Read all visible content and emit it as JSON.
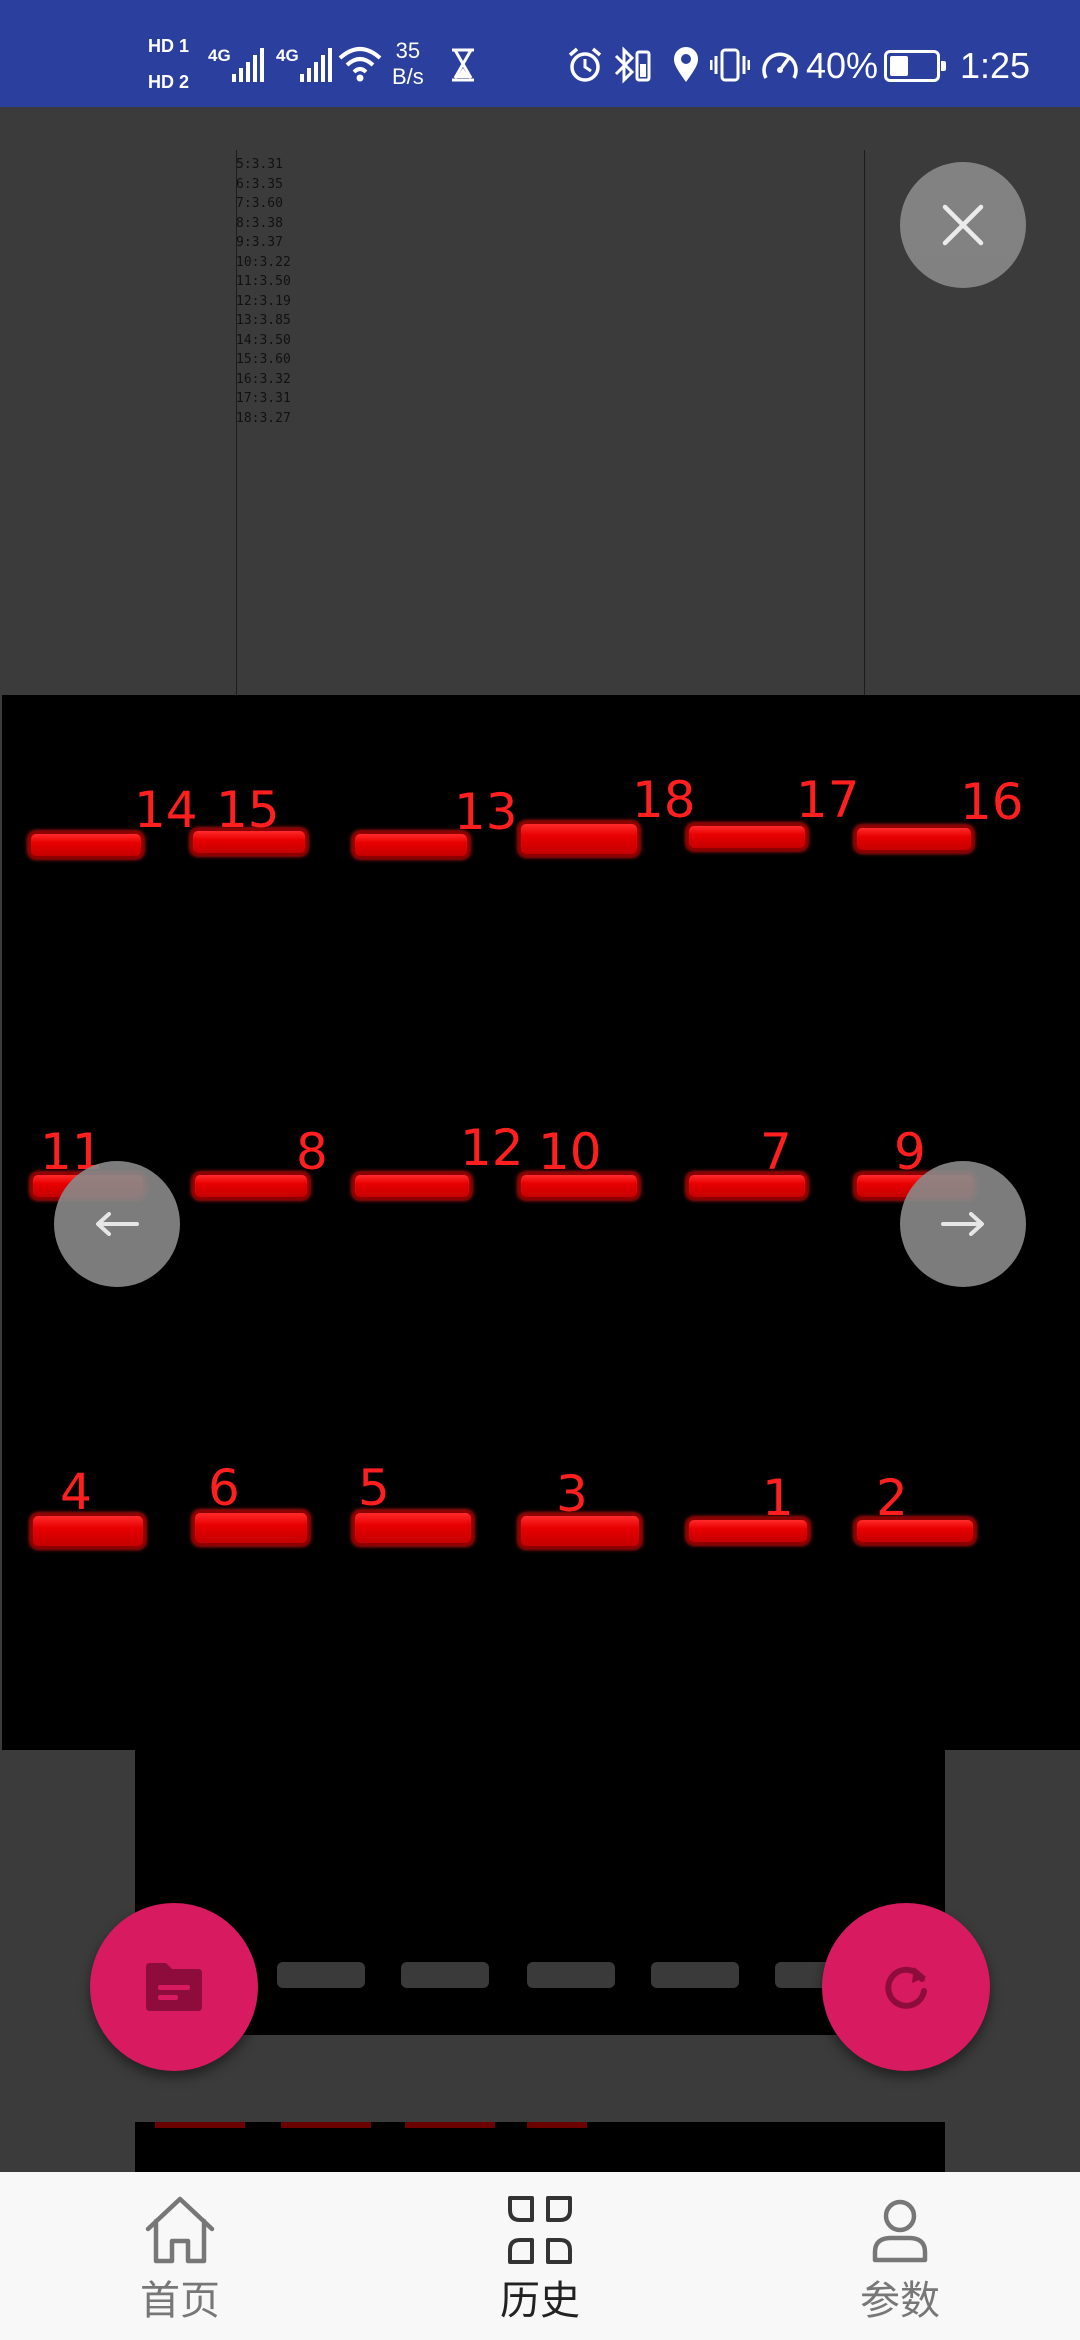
{
  "status_bar": {
    "sim1": "HD 1",
    "sim2": "HD 2",
    "network_1": "4G",
    "network_2": "4G",
    "speed_value": "35",
    "speed_unit": "B/s",
    "battery_percent": "40%",
    "battery_level": 0.4,
    "time": "1:25",
    "icons": [
      "hourglass-icon",
      "alarm-icon",
      "bluetooth-icon",
      "location-icon",
      "vibrate-icon",
      "speed-icon",
      "wifi-icon"
    ]
  },
  "results_list": [
    "5:3.31",
    "6:3.35",
    "7:3.60",
    "8:3.38",
    "9:3.37",
    "10:3.22",
    "11:3.50",
    "12:3.19",
    "13:3.85",
    "14:3.50",
    "15:3.60",
    "16:3.32",
    "17:3.31",
    "18:3.27"
  ],
  "gel_labels": [
    "1",
    "2",
    "3",
    "4",
    "5",
    "6",
    "7",
    "8",
    "9",
    "10",
    "11",
    "12",
    "13",
    "14",
    "15",
    "16",
    "17",
    "18"
  ],
  "bottom_nav": {
    "items": [
      {
        "label": "首页",
        "icon": "home-icon",
        "active": false
      },
      {
        "label": "历史",
        "icon": "history-grid-icon",
        "active": true
      },
      {
        "label": "参数",
        "icon": "person-icon",
        "active": false
      }
    ]
  },
  "colors": {
    "status_bar": "#2b3f9e",
    "fab": "#d81b60",
    "band": "#ff0000",
    "label": "#ff1f1f"
  }
}
